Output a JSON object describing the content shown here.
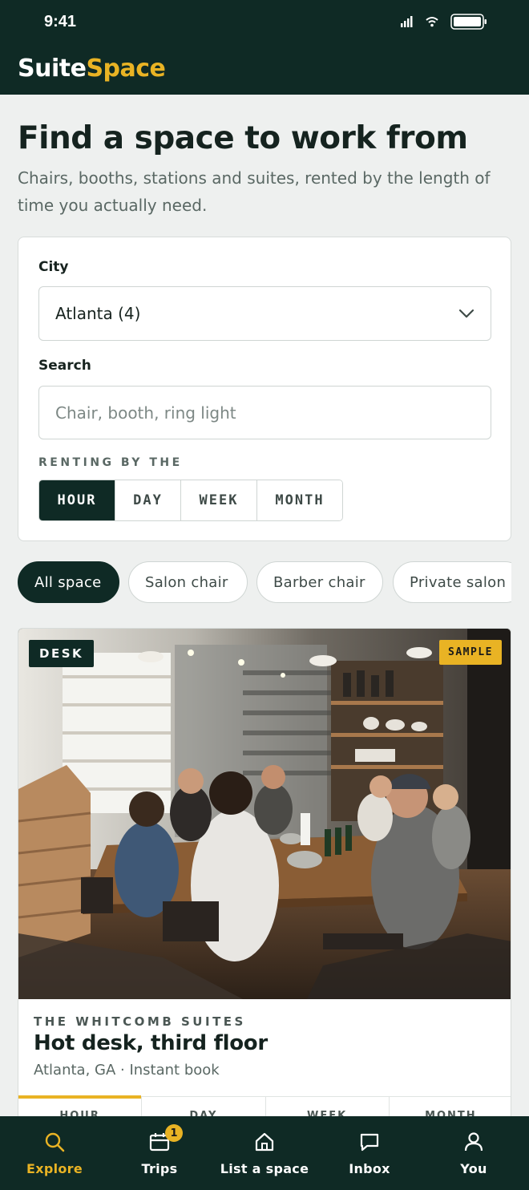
{
  "status_bar": {
    "time": "9:41"
  },
  "header": {
    "brand_first": "Suite",
    "brand_second": "Space"
  },
  "hero": {
    "title": "Find a space to work from",
    "subtitle": "Chairs, booths, stations and suites, rented by the length of time you actually need."
  },
  "search": {
    "city_label": "City",
    "city_value": "Atlanta (4)",
    "search_label": "Search",
    "search_placeholder": "Chair, booth, ring light",
    "renting_label": "RENTING BY THE",
    "durations": [
      "HOUR",
      "DAY",
      "WEEK",
      "MONTH"
    ],
    "selected_duration": "HOUR"
  },
  "filters": {
    "chips": [
      "All space",
      "Salon chair",
      "Barber chair",
      "Private salon"
    ],
    "active": "All space"
  },
  "listing": {
    "type_tag": "DESK",
    "sample_tag": "SAMPLE",
    "venue": "THE WHITCOMB SUITES",
    "title": "Hot desk, third floor",
    "meta": "Atlanta, GA · Instant book",
    "rate_tabs": [
      "HOUR",
      "DAY",
      "WEEK",
      "MONTH"
    ],
    "active_rate_tab": "HOUR"
  },
  "tab_bar": {
    "items": [
      {
        "label": "Explore",
        "icon": "search-icon"
      },
      {
        "label": "Trips",
        "icon": "calendar-icon",
        "badge": "1"
      },
      {
        "label": "List a space",
        "icon": "home-icon"
      },
      {
        "label": "Inbox",
        "icon": "chat-icon"
      },
      {
        "label": "You",
        "icon": "user-icon"
      }
    ],
    "active": "Explore"
  },
  "colors": {
    "brand_dark": "#0f2a25",
    "accent": "#e9b324",
    "background": "#eef0ef"
  }
}
